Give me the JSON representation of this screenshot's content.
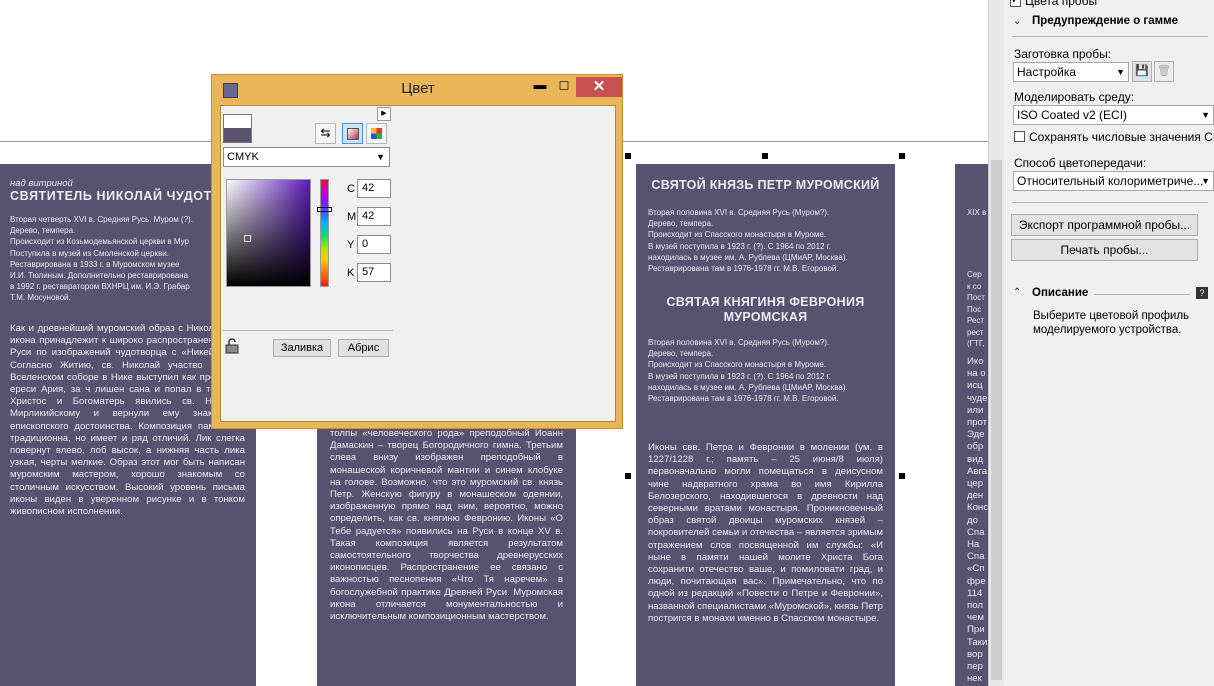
{
  "canvas": {
    "panel1": {
      "sup": "над витриной",
      "title": "СВЯТИТЕЛЬ НИКОЛАЙ ЧУДОТВО",
      "meta": "Вторая четверть XVI в. Средняя Русь. Муром (?).\nДерево, темпера.\nПроисходит из Козьмодемьянской церкви в Мур\nПоступила в музей из Смоленской церкви.\nРеставрирована в 1933 г. в Муромском музее\nИ.И. Тюлиным. Дополнительно реставрирована\nв 1992 г. реставратором ВХНРЦ им. И.Э. Грабар\nТ.М. Мосуновой.",
      "body": "Как и древнейший муромский образ с Николая, эта икона принадлежит к широко распространенных на Руси по изображений чудотворца с «Никейским ч Согласно Житию, св. Николай участво Первом Вселенском соборе в Нике выступил как противник ереси Ария, за ч лишен сана и попал в темницу. Христос и Богоматерь явились св. Николаю Мирликийскому и вернули ему знаки его епископского достоинства. Композиция памятника традиционна, но имеет и ряд отличий. Лик слегка повернут влево, лоб высок, а нижняя часть лика узкая, черты мелкие. Образ этот мог быть написан муромским мастером, хорошо знакомым со столичным искусством. Высокий уровень письма иконы виден в уверенном рисунке и в тонком живописном исполнении."
    },
    "panel2": {
      "body": "толпы «человеческого рода» преподобный Иоанн Дамаскин – творец Богородичного гимна. Третьим слева внизу изображен преподобный в монашеской коричневой мантии и синем клобуке на голове. Возможно, что это муромский св. князь Петр. Женскую фигуру в монашеском одеянии, изображенную прямо над ним, вероятно, можно определить, как св. княгиню Февронию. Иконы «О Тебе радуется» появились на Руси в конце XV в. Такая композиция является результатом самостоятельного творчества древнерусских иконописцев. Распространение ее связано с важностью песнопения «Что Тя наречем» в богослужебной практике Древней Руси. Муромская икона отличается монументальностью и исключительным композиционным мастерством."
    },
    "panel3": {
      "title1": "СВЯТОЙ КНЯЗЬ ПЕТР МУРОМСКИЙ",
      "meta1": "Вторая половина XVI в. Средняя Русь (Муром?).\nДерево, темпера.\nПроисходит из Спасского монастыря в Муроме.\nВ музей поступила в 1923 г. (?). С 1964 по 2012 г.\nнаходилась в музее им. А. Рублева (ЦМиАР, Москва).\nРеставрирована там в 1976-1978 гг. М.В. Егоровой.",
      "title2": "СВЯТАЯ КНЯГИНЯ ФЕВРОНИЯ МУРОМСКАЯ",
      "meta2": "Вторая половина XVI в. Средняя Русь (Муром?).\nДерево, темпера.\nПроисходит из Спасского монастыря в Муроме.\nВ музей поступила в 1923 г. (?). С 1964 по 2012 г.\nнаходилась в музее им. А. Рублева (ЦМиАР, Москва).\nРеставрирована там в 1976-1978 гг. М.В. Егоровой.",
      "body": "Иконы свв. Петра и Февронии в молении (ум. в 1227/1228 г.; память – 25 июня/8 июля) первоначально могли помещаться в деисусном чине надвратного храма во имя Кирилла Белозерского, находившегося в древности над северными вратами монастыря. Проникновенный образ святой двоицы муромских князей – покровителей семьи и отечества – является зримым отражением слов посвященной им службы: «И ныне в памяти нашей молите Христа Бога сохранити отечество ваше, и помиловати град, и люди, почитающая вас». Примечательно, что по одной из редакций «Повести о Петре и Февронии», названной специалистами «Муромской», князь Петр постригся в монахи именно в Спасском монастыре."
    },
    "panel4": {
      "line1": "XIX в",
      "lines2": "Сер\nк со\nПост\nПос\nРест\nрест\n(ГТГ,",
      "lines3": "Ико\nна о\nисц\nчуде\nили\nпрот\nЭде\nобр\nвид\nАвга\nцер\nден\nКонс\nдо\nСпа\nНа\nСпа\n«Сп\nфре\n114\nпол\nчем\nПри\nТаки\nвор\nпер\nнек"
    }
  },
  "dialog": {
    "title": "Цвет",
    "minimize": "▭",
    "maximize": "☐",
    "close": "✕",
    "model": "CMYK",
    "fields": {
      "c_label": "C",
      "c": "42",
      "m_label": "M",
      "m": "42",
      "y_label": "Y",
      "y": "0",
      "k_label": "K",
      "k": "57"
    },
    "buttons": {
      "fill": "Заливка",
      "outline": "Абрис"
    },
    "icons": {
      "sliders": "⇆",
      "viewer": "■",
      "palette": "▦",
      "lock": "🔓",
      "flyout": "▶"
    },
    "colors": {
      "current": "#5b5471",
      "new": "#ffffff"
    }
  },
  "docker": {
    "proof_colors_label": "Цвета пробы",
    "gamut_section": "Предупреждение о гамме",
    "preset_label": "Заготовка пробы:",
    "preset_value": "Настройка",
    "simulate_label": "Моделировать среду:",
    "simulate_value": "ISO Coated v2 (ECI)",
    "preserve_label": "Сохранять числовые значения CMYK",
    "rendering_label": "Способ цветопередачи:",
    "rendering_value": "Относительный колориметриче...",
    "export_button": "Экспорт программной пробы...",
    "print_button": "Печать пробы...",
    "description_section": "Описание",
    "description_text": "Выберите цветовой профиль моделируемого устройства."
  }
}
